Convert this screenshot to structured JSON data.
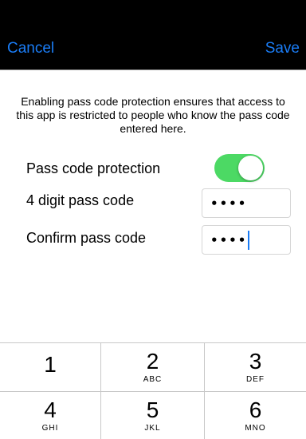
{
  "nav": {
    "cancel_label": "Cancel",
    "save_label": "Save",
    "accent_color": "#1a7cf5"
  },
  "description": "Enabling pass code protection ensures that access to this app is restricted to people who know the pass code entered here.",
  "settings": {
    "protection_label": "Pass code protection",
    "protection_enabled": true,
    "toggle_color": "#4cd964",
    "code_label": "4 digit pass code",
    "code_value": "••••",
    "confirm_label": "Confirm pass code",
    "confirm_value": "••••"
  },
  "keypad": {
    "keys": [
      {
        "num": "1",
        "letters": ""
      },
      {
        "num": "2",
        "letters": "ABC"
      },
      {
        "num": "3",
        "letters": "DEF"
      },
      {
        "num": "4",
        "letters": "GHI"
      },
      {
        "num": "5",
        "letters": "JKL"
      },
      {
        "num": "6",
        "letters": "MNO"
      }
    ]
  }
}
